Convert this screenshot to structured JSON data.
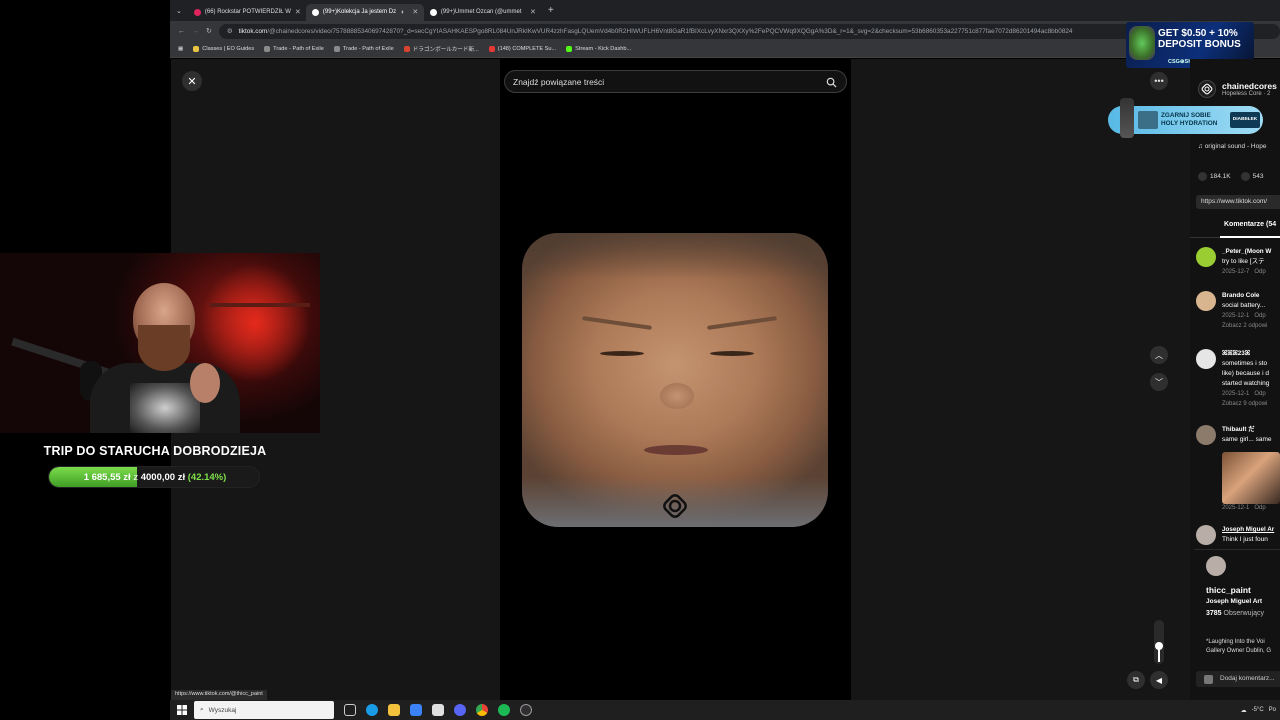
{
  "browser": {
    "tabs": [
      {
        "title": "(66) Rockstar POTWIERDZIŁ W",
        "color": "#e0245e",
        "active": false
      },
      {
        "title": "(99+)Kolekcja Ja jestem Dz",
        "color": "#ffffff",
        "active": true
      },
      {
        "title": "(99+)Ummet Ozcan (@ummet",
        "color": "#ffffff",
        "active": false
      }
    ],
    "url_domain": "tiktok.com",
    "url_rest": "/@chainedcores/video/7578888534069742870?_d=secCgYIASAHKAESPgo8RL084UnJRkIKwVUR4zzhFasgLQUemVd4b0R2HIWUFLH6Vnt8GaR1fBIXcLvyXNxr3QXXy%2FePQCVWq9XQGgA%3D&_r=1&_svg=2&checksum=53b6860353a227751c877fae7072d86201494ac8bb0824",
    "bookmarks": [
      {
        "label": "Classes | EO Guides",
        "color": "#e8c542"
      },
      {
        "label": "Trade - Path of Exile",
        "color": "#8a8a8a"
      },
      {
        "label": "Trade - Path of Exile",
        "color": "#8a8a8a"
      },
      {
        "label": "ドラゴンボールカード新...",
        "color": "#d9432f"
      },
      {
        "label": "(148) COMPLETE Su...",
        "color": "#e53935"
      },
      {
        "label": "Stream - Kick Dashb...",
        "color": "#53fc18"
      }
    ],
    "status_url": "https://www.tiktok.com/@thicc_paint"
  },
  "viewer": {
    "search_placeholder": "Znajdź powiązane treści"
  },
  "post": {
    "author_handle": "chainedcores",
    "author_sub": "Hopeless Core · 2",
    "sound": "original sound - Hope",
    "likes": "184.1K",
    "comments": "543",
    "link": "https://www.tiktok.com/",
    "comments_tab": "Komentarze (54"
  },
  "comments": [
    {
      "name": "_Peter_(Moon W",
      "text": [
        "try to like [ステ"
      ],
      "date": "2025-12-7",
      "reply": "Odp",
      "more": "",
      "avatar": "#9acd32"
    },
    {
      "name": "Brando Cole",
      "text": [
        "social battery..."
      ],
      "date": "2025-12-1",
      "reply": "Odp",
      "more": "Zobacz 2 odpowi",
      "avatar": "#d8b58f"
    },
    {
      "name": "ꕤꕤꕤ23ꕤ",
      "text": [
        "sometimes i sto",
        "like) because i d",
        "started watching"
      ],
      "date": "2025-12-1",
      "reply": "Odp",
      "more": "Zobacz 9 odpowi",
      "avatar": "#e6e6e6"
    },
    {
      "name": "Thibault だ",
      "text": [
        "same girl... same"
      ],
      "date": "2025-12-1",
      "reply": "Odp",
      "more": "",
      "avatar": "#8c7a6b"
    },
    {
      "name": "Joseph Miguel Ar",
      "text": [
        "Think I just foun"
      ],
      "date": "",
      "reply": "",
      "more": "",
      "avatar": "#b9aea7"
    }
  ],
  "profile_popup": {
    "username": "thicc_paint",
    "display_name": "Joseph Miguel Art",
    "followers_count": "3785",
    "followers_label": "Obserwujący",
    "bio": [
      "*Laughing Into the Voi",
      "Gallery Owner Dublin, G"
    ]
  },
  "add_comment": "Dodaj komentarz...",
  "volume_level": 0.4,
  "ads": {
    "top_line1": "GET $0.50 + 10%",
    "top_line2": "DEPOSIT BONUS",
    "top_brand": "CSG⊕SKINS",
    "drink_line1": "ZGARNIJ SOBIE",
    "drink_line2": "HOLY HYDRATION",
    "drink_badge": "DIABEŁEK"
  },
  "stream_overlay": {
    "goal_title": "TRIP DO STARUCHA DOBRODZIEJA",
    "current": "1 685,55 zł",
    "separator": "z",
    "target": "4000,00 zł",
    "percent": "(42.14%)",
    "progress": 0.4214
  },
  "taskbar": {
    "search_placeholder": "Wyszukaj",
    "tray_temp": "-5°C",
    "tray_text": "Po"
  },
  "colors": {
    "goal_green": "#7fe04a",
    "tiktok_bg": "#121212"
  }
}
